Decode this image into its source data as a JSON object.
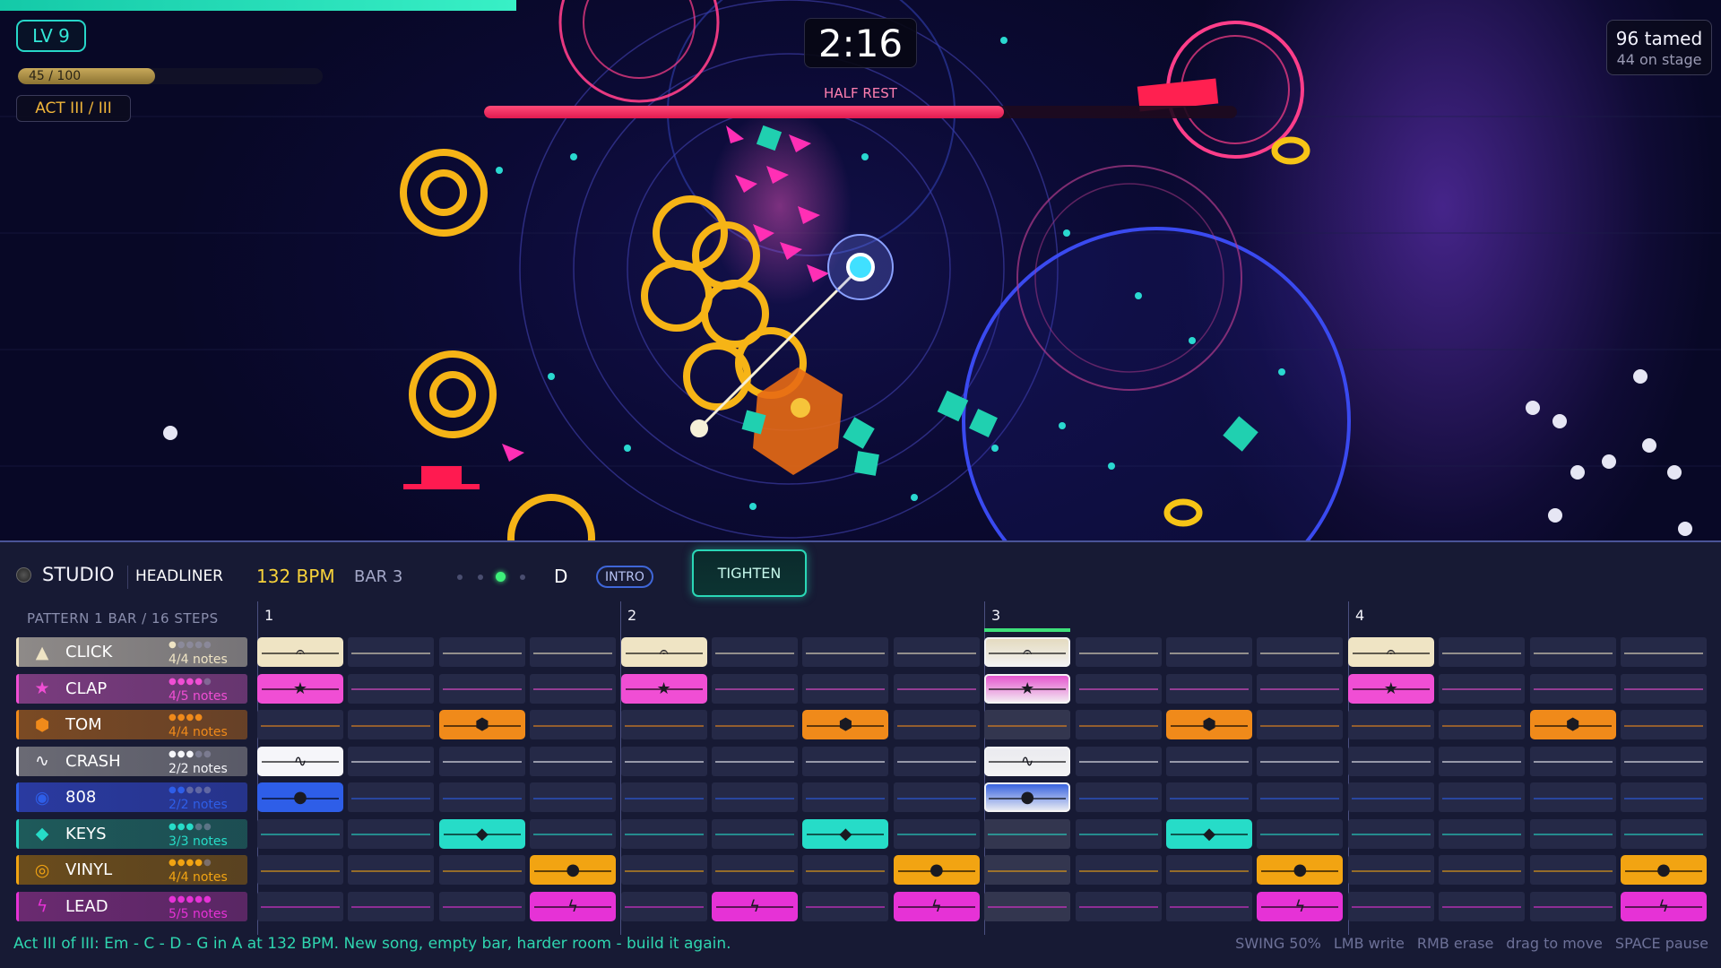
{
  "hud": {
    "level": "LV 9",
    "xp_text": "45 / 100",
    "xp_fraction": 0.45,
    "act": "ACT III / III",
    "timer": "2:16",
    "boss_phase": "HALF REST",
    "boss_health_fraction": 0.69,
    "tamed": "96 tamed",
    "on_stage": "44 on stage",
    "top_progress_fraction": 0.3
  },
  "studio": {
    "title": "STUDIO",
    "rank": "HEADLINER",
    "bpm": "132 BPM",
    "bar": "BAR 3",
    "beat_active": 2,
    "key": "D",
    "section": "INTRO",
    "action_button": "TIGHTEN",
    "pattern_label": "PATTERN  1 BAR / 16 STEPS",
    "bar_markers": [
      "1",
      "2",
      "3",
      "4"
    ],
    "playhead_step": 8
  },
  "tracks": [
    {
      "name": "CLICK",
      "icon": "metronome-icon",
      "notes": "4/4 notes",
      "dots": "●●●●●",
      "filled_dots": 1,
      "color": "#efe4c4",
      "label_bg": "#8e8a88",
      "glyph": "𝄐",
      "steps": [
        0,
        4,
        8,
        12
      ]
    },
    {
      "name": "CLAP",
      "icon": "star-icon",
      "notes": "4/5 notes",
      "dots": "●●●●●",
      "filled_dots": 4,
      "color": "#f04ed4",
      "label_bg": "#7a3c7e",
      "glyph": "★",
      "steps": [
        0,
        4,
        8,
        12
      ]
    },
    {
      "name": "TOM",
      "icon": "hexagon-icon",
      "notes": "4/4 notes",
      "dots": "●●●●",
      "filled_dots": 4,
      "color": "#f08a1a",
      "label_bg": "#7a4a24",
      "glyph": "⬢",
      "steps": [
        2,
        6,
        10,
        14
      ]
    },
    {
      "name": "CRASH",
      "icon": "wave-icon",
      "notes": "2/2 notes",
      "dots": "●●●●●",
      "filled_dots": 3,
      "color": "#f6f6fa",
      "label_bg": "#6a6a74",
      "glyph": "∿",
      "steps": [
        0,
        8
      ]
    },
    {
      "name": "808",
      "icon": "orb-icon",
      "notes": "2/2 notes",
      "dots": "●●●●●",
      "filled_dots": 2,
      "color": "#2e5ee8",
      "label_bg": "#2a3aa0",
      "glyph": "●",
      "steps": [
        0,
        8
      ]
    },
    {
      "name": "KEYS",
      "icon": "diamond-icon",
      "notes": "3/3 notes",
      "dots": "●●●●●",
      "filled_dots": 3,
      "color": "#26dcc8",
      "label_bg": "#1e5a5a",
      "glyph": "◆",
      "steps": [
        2,
        6,
        10
      ]
    },
    {
      "name": "VINYL",
      "icon": "record-icon",
      "notes": "4/4 notes",
      "dots": "●●●●●",
      "filled_dots": 4,
      "color": "#f2a412",
      "label_bg": "#6a4c1c",
      "glyph": "●",
      "steps": [
        3,
        7,
        11,
        15
      ]
    },
    {
      "name": "LEAD",
      "icon": "bolt-icon",
      "notes": "5/5 notes",
      "dots": "●●●●●",
      "filled_dots": 5,
      "color": "#e632d6",
      "label_bg": "#6a2a70",
      "glyph": "ϟ",
      "steps": [
        3,
        5,
        7,
        11,
        15
      ]
    }
  ],
  "footer": {
    "message": "Act III of III: Em - C - D - G in A at 132 BPM. New song, empty bar, harder room - build it again.",
    "hints": [
      "SWING 50%",
      "LMB write",
      "RMB erase",
      "drag to move",
      "SPACE pause"
    ]
  },
  "colors": {
    "accent_teal": "#2ad7b6",
    "boss_red": "#e01a50",
    "bpm_yellow": "#f7d23a"
  }
}
